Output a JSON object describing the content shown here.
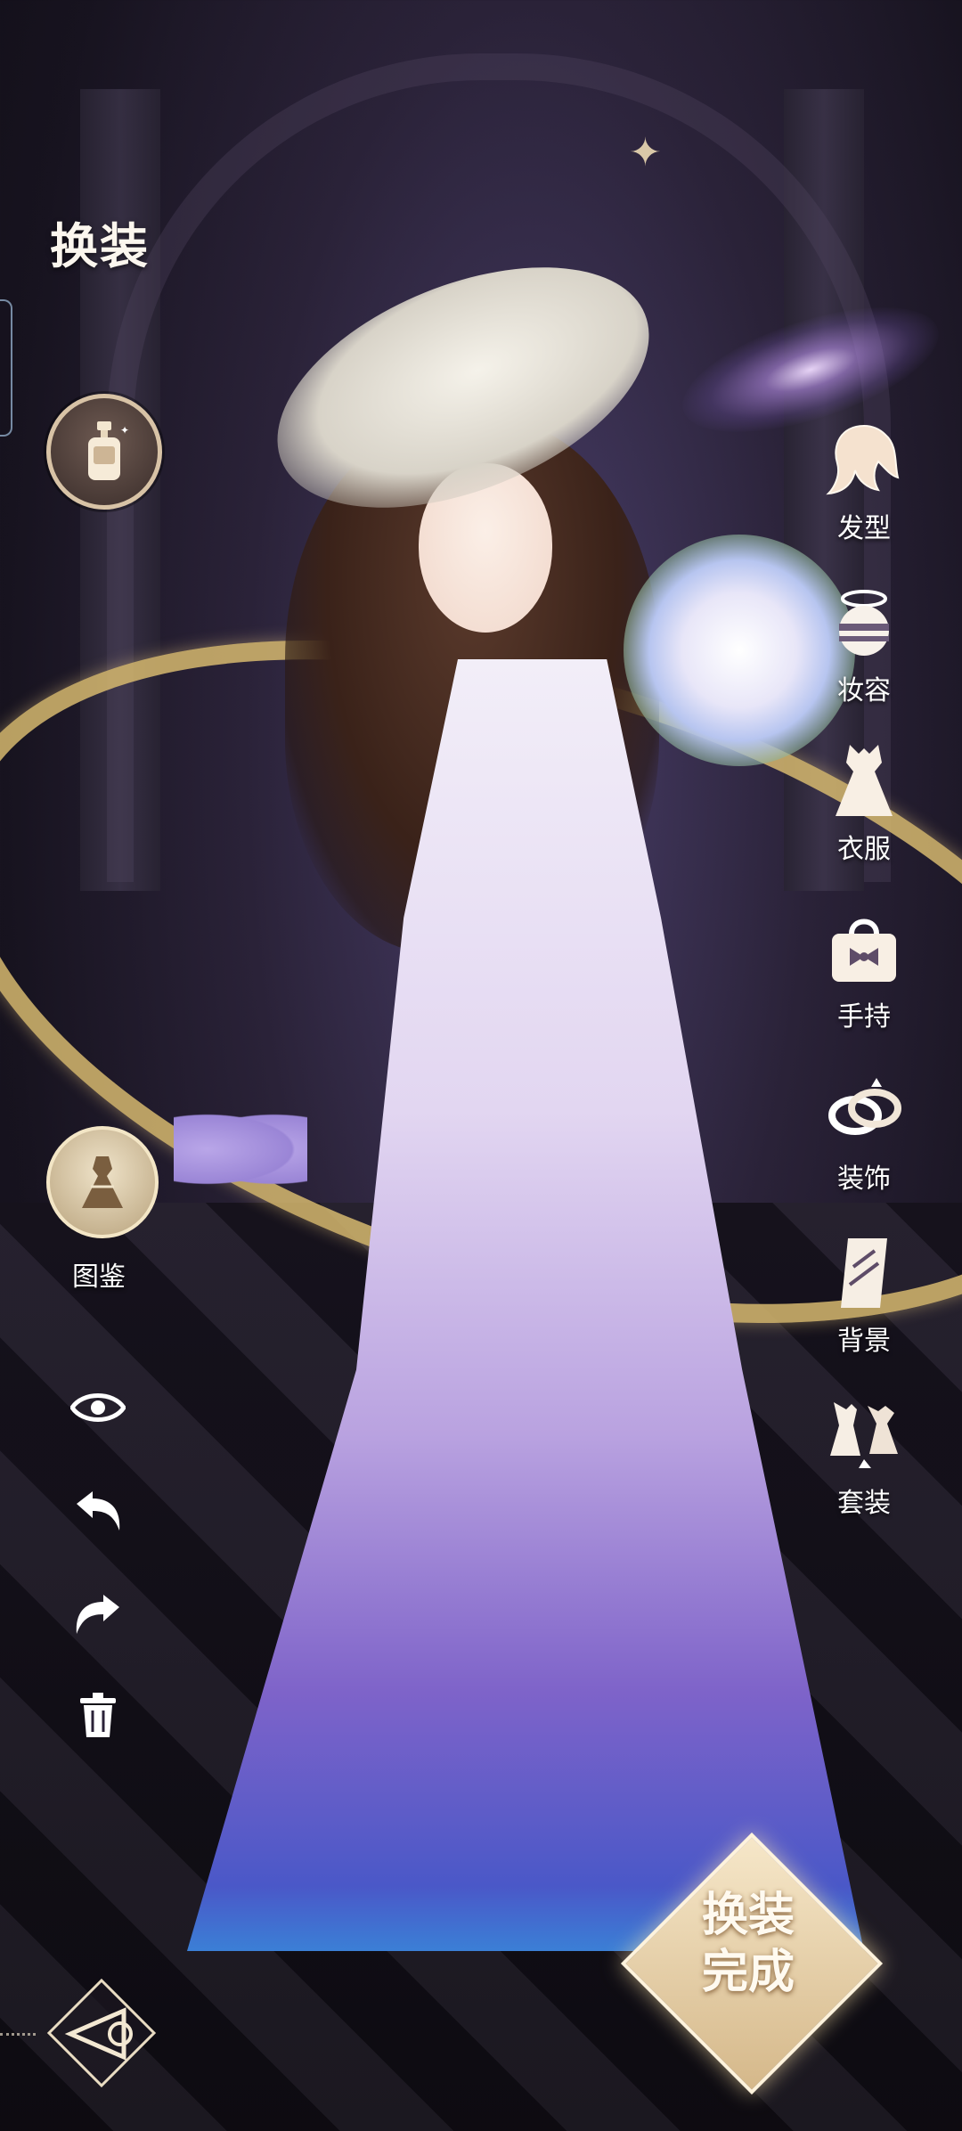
{
  "header": {
    "title": "换装"
  },
  "categories": [
    {
      "label": "发型",
      "icon": "hair-icon"
    },
    {
      "label": "妆容",
      "icon": "makeup-icon"
    },
    {
      "label": "衣服",
      "icon": "dress-icon"
    },
    {
      "label": "手持",
      "icon": "handbag-icon"
    },
    {
      "label": "装饰",
      "icon": "rings-icon"
    },
    {
      "label": "背景",
      "icon": "background-icon"
    },
    {
      "label": "套装",
      "icon": "outfit-set-icon"
    }
  ],
  "left_panel": {
    "spray_icon": "spray-bottle-icon",
    "codex_label": "图鉴",
    "codex_icon": "dress-catalog-icon"
  },
  "tools": [
    {
      "icon": "eye-icon"
    },
    {
      "icon": "undo-icon"
    },
    {
      "icon": "redo-icon"
    },
    {
      "icon": "trash-icon"
    }
  ],
  "done_button": {
    "line1": "换装",
    "line2": "完成"
  },
  "back_button": {
    "icon": "back-triangle-icon"
  },
  "colors": {
    "gold": "#d6b86e",
    "label": "#ffffff",
    "accent_purple": "#7e63c9"
  }
}
